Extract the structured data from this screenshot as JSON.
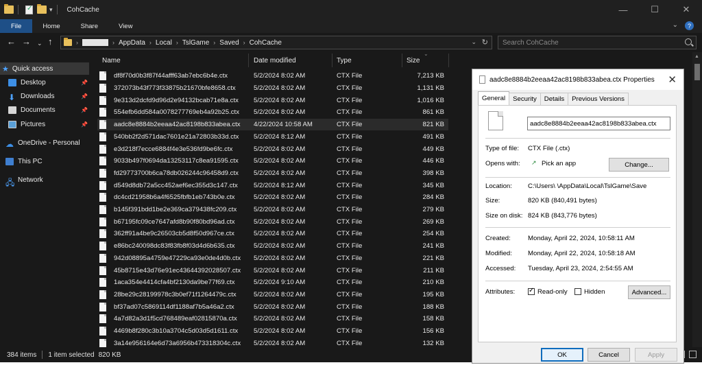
{
  "window": {
    "title": "CohCache",
    "minimize": "—",
    "maximize": "☐",
    "close": "✕"
  },
  "ribbon": {
    "tabs": [
      "File",
      "Home",
      "Share",
      "View"
    ],
    "collapse": "⌄",
    "help": "?"
  },
  "address": {
    "back": "←",
    "forward": "→",
    "recent": "⌄",
    "up": "↑",
    "crumbs": [
      "AppData",
      "Local",
      "TslGame",
      "Saved",
      "CohCache"
    ],
    "search_placeholder": "Search CohCache"
  },
  "nav": {
    "quick_access": "Quick access",
    "desktop": "Desktop",
    "downloads": "Downloads",
    "documents": "Documents",
    "pictures": "Pictures",
    "onedrive": "OneDrive - Personal",
    "this_pc": "This PC",
    "network": "Network"
  },
  "columns": {
    "name": "Name",
    "date": "Date modified",
    "type": "Type",
    "size": "Size"
  },
  "files": [
    {
      "name": "df8f70d0b3f87f44afff63ab7ebc6b4e.ctx",
      "date": "5/2/2024 8:02 AM",
      "type": "CTX File",
      "size": "7,213 KB"
    },
    {
      "name": "372073b43f773f33875b21670bfe8658.ctx",
      "date": "5/2/2024 8:02 AM",
      "type": "CTX File",
      "size": "1,131 KB"
    },
    {
      "name": "9e313d2dcfd9d96d2e94132bcab71e8a.ctx",
      "date": "5/2/2024 8:02 AM",
      "type": "CTX File",
      "size": "1,016 KB"
    },
    {
      "name": "554efb6dd584a0078277769eb4a92b25.ctx",
      "date": "5/2/2024 8:02 AM",
      "type": "CTX File",
      "size": "861 KB"
    },
    {
      "name": "aadc8e8884b2eeaa42ac8198b833abea.ctx",
      "date": "4/22/2024 10:58 AM",
      "type": "CTX File",
      "size": "821 KB"
    },
    {
      "name": "540bb2f2d571dac7601e21a72803b33d.ctx",
      "date": "5/2/2024 8:12 AM",
      "type": "CTX File",
      "size": "491 KB"
    },
    {
      "name": "e3d218f7ecce6884f4e3e536fd9be6fc.ctx",
      "date": "5/2/2024 8:02 AM",
      "type": "CTX File",
      "size": "449 KB"
    },
    {
      "name": "9033b497f0694da13253117c8ea91595.ctx",
      "date": "5/2/2024 8:02 AM",
      "type": "CTX File",
      "size": "446 KB"
    },
    {
      "name": "fd29773700b6ca78db026244c96458d9.ctx",
      "date": "5/2/2024 8:02 AM",
      "type": "CTX File",
      "size": "398 KB"
    },
    {
      "name": "d549d8db72a5cc452aef6ec355d3c147.ctx",
      "date": "5/2/2024 8:12 AM",
      "type": "CTX File",
      "size": "345 KB"
    },
    {
      "name": "dc4cd21958b6a4f6525fbfb1eb743b0e.ctx",
      "date": "5/2/2024 8:02 AM",
      "type": "CTX File",
      "size": "284 KB"
    },
    {
      "name": "b145f391bdd1be2e369ca379438fc209.ctx",
      "date": "5/2/2024 8:02 AM",
      "type": "CTX File",
      "size": "279 KB"
    },
    {
      "name": "b67195fc09ce7647afd8b90f80bd96ad.ctx",
      "date": "5/2/2024 8:02 AM",
      "type": "CTX File",
      "size": "269 KB"
    },
    {
      "name": "362ff91a4be9c26503cb5d8f50d967ce.ctx",
      "date": "5/2/2024 8:02 AM",
      "type": "CTX File",
      "size": "254 KB"
    },
    {
      "name": "e86bc240098dc83f83fb8f03d4d6b635.ctx",
      "date": "5/2/2024 8:02 AM",
      "type": "CTX File",
      "size": "241 KB"
    },
    {
      "name": "942d08895a4759e47229ca93e0de4d0b.ctx",
      "date": "5/2/2024 8:02 AM",
      "type": "CTX File",
      "size": "221 KB"
    },
    {
      "name": "45b8715e43d76e91ec43644392028507.ctx",
      "date": "5/2/2024 8:02 AM",
      "type": "CTX File",
      "size": "211 KB"
    },
    {
      "name": "1aca354e4414cfa4bf2130da9be77f69.ctx",
      "date": "5/2/2024 9:10 AM",
      "type": "CTX File",
      "size": "210 KB"
    },
    {
      "name": "28be29c28199978c3b0ef71f1264479c.ctx",
      "date": "5/2/2024 8:02 AM",
      "type": "CTX File",
      "size": "195 KB"
    },
    {
      "name": "bf37ad07c5869114df1188af7b5a46a2.ctx",
      "date": "5/2/2024 8:02 AM",
      "type": "CTX File",
      "size": "188 KB"
    },
    {
      "name": "4a7d82a3d1f5cd768489eaf02815870a.ctx",
      "date": "5/2/2024 8:02 AM",
      "type": "CTX File",
      "size": "158 KB"
    },
    {
      "name": "4469b8f280c3b10a3704c5d03d5d1611.ctx",
      "date": "5/2/2024 8:02 AM",
      "type": "CTX File",
      "size": "156 KB"
    },
    {
      "name": "3a14e956164e6d73a6956b473318304c.ctx",
      "date": "5/2/2024 8:02 AM",
      "type": "CTX File",
      "size": "132 KB"
    }
  ],
  "selected_index": 4,
  "status": {
    "count": "384 items",
    "selected": "1 item selected",
    "size": "820 KB"
  },
  "dialog": {
    "title": "aadc8e8884b2eeaa42ac8198b833abea.ctx Properties",
    "close": "✕",
    "tabs": [
      "General",
      "Security",
      "Details",
      "Previous Versions"
    ],
    "filename": "aadc8e8884b2eeaa42ac8198b833abea.ctx",
    "type_label": "Type of file:",
    "type_value": "CTX File (.ctx)",
    "opens_label": "Opens with:",
    "opens_value": "Pick an app",
    "change_btn": "Change...",
    "location_label": "Location:",
    "location_value": "C:\\Users\\           \\AppData\\Local\\TslGame\\Save",
    "size_label": "Size:",
    "size_value": "820 KB (840,491 bytes)",
    "disk_label": "Size on disk:",
    "disk_value": "824 KB (843,776 bytes)",
    "created_label": "Created:",
    "created_value": "Monday, April 22, 2024, 10:58:11 AM",
    "modified_label": "Modified:",
    "modified_value": "Monday, April 22, 2024, 10:58:18 AM",
    "accessed_label": "Accessed:",
    "accessed_value": "Tuesday, April 23, 2024, 2:54:55 AM",
    "attributes_label": "Attributes:",
    "readonly_label": "Read-only",
    "hidden_label": "Hidden",
    "advanced_btn": "Advanced...",
    "ok_btn": "OK",
    "cancel_btn": "Cancel",
    "apply_btn": "Apply"
  }
}
